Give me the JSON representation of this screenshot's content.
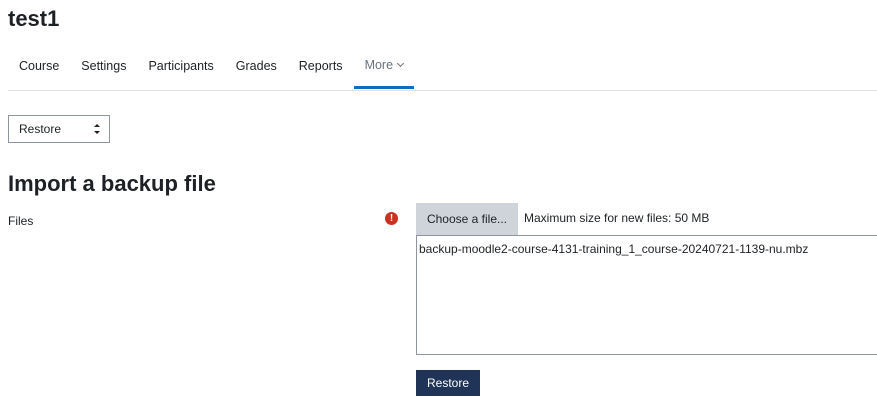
{
  "course": {
    "title": "test1"
  },
  "nav": {
    "items": [
      {
        "label": "Course"
      },
      {
        "label": "Settings"
      },
      {
        "label": "Participants"
      },
      {
        "label": "Grades"
      },
      {
        "label": "Reports"
      },
      {
        "label": "More"
      }
    ],
    "active_index": 5
  },
  "action_select": {
    "selected": "Restore"
  },
  "section": {
    "heading": "Import a backup file"
  },
  "files_field": {
    "label": "Files",
    "required_icon_glyph": "!",
    "choose_button_label": "Choose a file...",
    "max_size_text": "Maximum size for new files: 50 MB",
    "file_name": "backup-moodle2-course-4131-training_1_course-20240721-1139-nu.mbz"
  },
  "restore_button": {
    "label": "Restore"
  },
  "colors": {
    "active_tab_underline": "#0f6cbf",
    "required_icon": "#ca3120",
    "primary_button": "#1f3457",
    "secondary_button": "#ced4da"
  }
}
